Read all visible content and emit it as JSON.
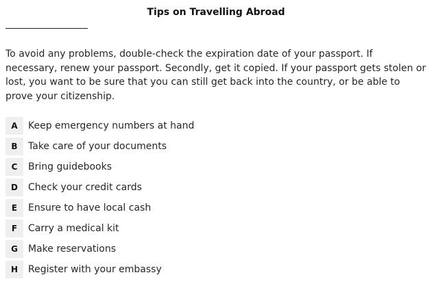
{
  "page": {
    "title": "Tips on Travelling Abroad",
    "paragraph": "To avoid any problems, double-check the expiration date of your passport. If necessary, renew your passport. Secondly, get it copied. If your passport gets stolen or lost, you want to be sure that you can still get back into the country, or be able to prove your citizenship."
  },
  "options": [
    {
      "letter": "A",
      "text": "Keep emergency numbers at hand"
    },
    {
      "letter": "B",
      "text": "Take care of your documents"
    },
    {
      "letter": "C",
      "text": "Bring guidebooks"
    },
    {
      "letter": "D",
      "text": "Check your credit cards"
    },
    {
      "letter": "E",
      "text": "Ensure to have local cash"
    },
    {
      "letter": "F",
      "text": "Carry a medical kit"
    },
    {
      "letter": "G",
      "text": "Make reservations"
    },
    {
      "letter": "H",
      "text": "Register with your embassy"
    }
  ],
  "colors": {
    "letter_box_background": "#efefef",
    "text": "#262626",
    "title": "#111111"
  }
}
